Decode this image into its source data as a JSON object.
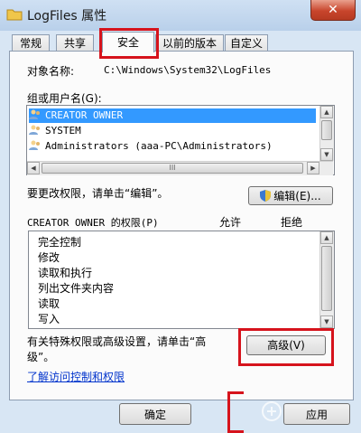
{
  "window": {
    "title": "LogFiles 属性",
    "close_label": "✕"
  },
  "tabs": [
    {
      "label": "常规"
    },
    {
      "label": "共享"
    },
    {
      "label": "安全"
    },
    {
      "label": "以前的版本"
    },
    {
      "label": "自定义"
    }
  ],
  "active_tab": "安全",
  "object": {
    "label": "对象名称:",
    "value": "C:\\Windows\\System32\\LogFiles"
  },
  "groups": {
    "label": "组或用户名(G):",
    "items": [
      {
        "name": "CREATOR OWNER",
        "selected": true
      },
      {
        "name": "SYSTEM",
        "selected": false
      },
      {
        "name": "Administrators (aaa-PC\\Administrators)",
        "selected": false
      }
    ],
    "hscroll_grip": "III"
  },
  "edit": {
    "hint": "要更改权限，请单击“编辑”。",
    "button_label": "编辑(E)..."
  },
  "permissions": {
    "label": "CREATOR OWNER 的权限(P)",
    "allow_header": "允许",
    "deny_header": "拒绝",
    "items": [
      {
        "name": "完全控制"
      },
      {
        "name": "修改"
      },
      {
        "name": "读取和执行"
      },
      {
        "name": "列出文件夹内容"
      },
      {
        "name": "读取"
      },
      {
        "name": "写入"
      }
    ]
  },
  "advanced": {
    "hint_line1": "有关特殊权限或高级设置，请单击“高",
    "hint_line2": "级”。",
    "button_label": "高级(V)"
  },
  "learn_link": "了解访问控制和权限",
  "footer": {
    "ok_label": "确定",
    "apply_label": "应用"
  },
  "colors": {
    "highlight_red": "#d6131c",
    "selection_blue": "#3399ff",
    "link_blue": "#0033cc"
  }
}
